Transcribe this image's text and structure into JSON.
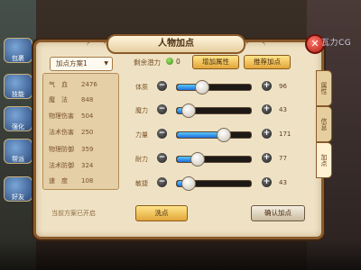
{
  "window": {
    "title": "人物加点",
    "watermark": "瓦力CG"
  },
  "side_buttons": [
    "包裹",
    "技能",
    "强化",
    "帮派",
    "好友"
  ],
  "scheme": {
    "selected": "加点方案1"
  },
  "stats": [
    {
      "label": "气　血",
      "value": "2476"
    },
    {
      "label": "魔　法",
      "value": "848"
    },
    {
      "label": "物理伤害",
      "value": "504"
    },
    {
      "label": "法术伤害",
      "value": "250"
    },
    {
      "label": "物理防御",
      "value": "359"
    },
    {
      "label": "法术防御",
      "value": "324"
    },
    {
      "label": "速　度",
      "value": "108"
    }
  ],
  "status": "当前方案已开启",
  "remaining": {
    "label": "剩余潜力",
    "value": "0"
  },
  "buttons": {
    "add_attr": "增加属性",
    "recommend": "推荐加点",
    "wash": "洗点",
    "confirm": "确认加点"
  },
  "attributes": [
    {
      "label": "体质",
      "value": "96",
      "fraction": 0.33
    },
    {
      "label": "魔力",
      "value": "43",
      "fraction": 0.15
    },
    {
      "label": "力量",
      "value": "171",
      "fraction": 0.62
    },
    {
      "label": "耐力",
      "value": "77",
      "fraction": 0.27
    },
    {
      "label": "敏捷",
      "value": "43",
      "fraction": 0.15
    }
  ],
  "tabs": [
    {
      "label": "属性",
      "active": false
    },
    {
      "label": "信息",
      "active": false
    },
    {
      "label": "加点",
      "active": true
    }
  ],
  "colors": {
    "accent": "#e2a63a",
    "slider_fill": "#1f6fd8",
    "panel_bg": "#efe2c4"
  }
}
